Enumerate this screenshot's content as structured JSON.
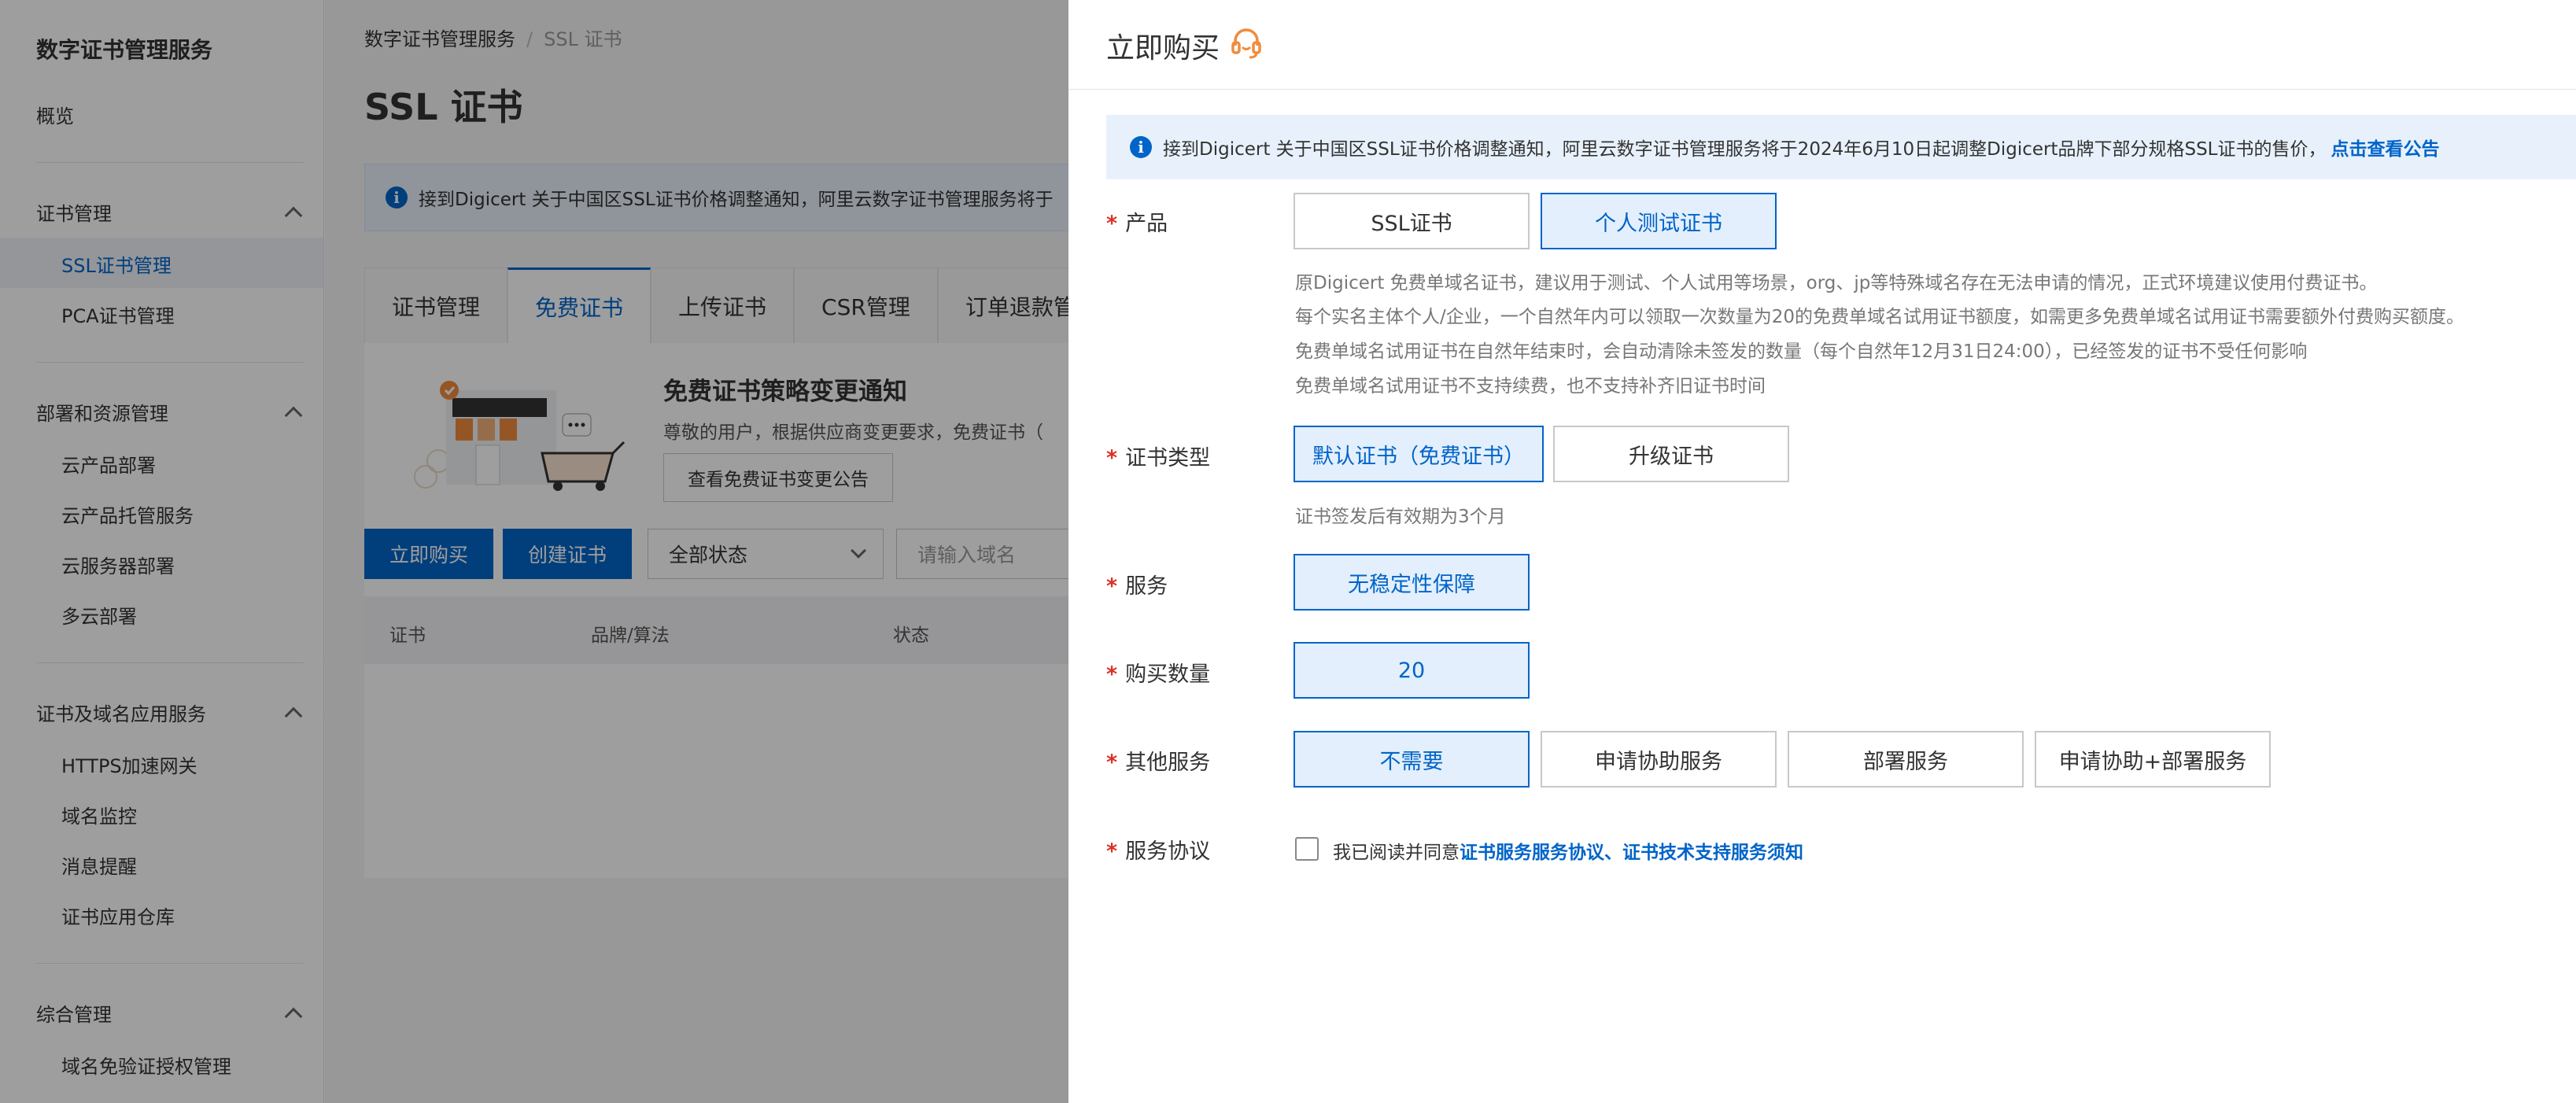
{
  "sidebar": {
    "title": "数字证书管理服务",
    "overview": "概览",
    "groups": [
      {
        "label": "证书管理",
        "items": [
          "SSL证书管理",
          "PCA证书管理"
        ]
      },
      {
        "label": "部署和资源管理",
        "items": [
          "云产品部署",
          "云产品托管服务",
          "云服务器部署",
          "多云部署"
        ]
      },
      {
        "label": "证书及域名应用服务",
        "items": [
          "HTTPS加速网关",
          "域名监控",
          "消息提醒",
          "证书应用仓库"
        ]
      },
      {
        "label": "综合管理",
        "items": [
          "域名免验证授权管理"
        ]
      }
    ],
    "active_item": "SSL证书管理"
  },
  "main": {
    "breadcrumb": {
      "root": "数字证书管理服务",
      "separator": "/",
      "current": "SSL 证书"
    },
    "title": "SSL 证书",
    "notice": "接到Digicert 关于中国区SSL证书价格调整通知，阿里云数字证书管理服务将于",
    "tabs": [
      "证书管理",
      "免费证书",
      "上传证书",
      "CSR管理",
      "订单退款管理"
    ],
    "active_tab": "免费证书",
    "promo": {
      "title": "免费证书策略变更通知",
      "desc": "尊敬的用户，根据供应商变更要求，免费证书（",
      "button": "查看免费证书变更公告"
    },
    "toolbar": {
      "buy_button": "立即购买",
      "create_button": "创建证书",
      "status_select": "全部状态",
      "search_placeholder": "请输入域名"
    },
    "table_headers": [
      "证书",
      "品牌/算法",
      "状态"
    ]
  },
  "drawer": {
    "title": "立即购买",
    "notice": "接到Digicert 关于中国区SSL证书价格调整通知，阿里云数字证书管理服务将于2024年6月10日起调整Digicert品牌下部分规格SSL证书的售价，",
    "notice_link": "点击查看公告",
    "product": {
      "label": "产品",
      "options": [
        "SSL证书",
        "个人测试证书"
      ],
      "selected": "个人测试证书",
      "help": [
        "原Digicert 免费单域名证书，建议用于测试、个人试用等场景，org、jp等特殊域名存在无法申请的情况，正式环境建议使用付费证书。",
        "每个实名主体个人/企业，一个自然年内可以领取一次数量为20的免费单域名试用证书额度，如需更多免费单域名试用证书需要额外付费购买额度。",
        "免费单域名试用证书在自然年结束时，会自动清除未签发的数量（每个自然年12月31日24:00），已经签发的证书不受任何影响",
        "免费单域名试用证书不支持续费，也不支持补齐旧证书时间"
      ]
    },
    "cert_type": {
      "label": "证书类型",
      "options": [
        "默认证书（免费证书）",
        "升级证书"
      ],
      "selected": "默认证书（免费证书）",
      "help": "证书签发后有效期为3个月"
    },
    "service": {
      "label": "服务",
      "options": [
        "无稳定性保障"
      ],
      "selected": "无稳定性保障"
    },
    "quantity": {
      "label": "购买数量",
      "value": "20"
    },
    "other_service": {
      "label": "其他服务",
      "options": [
        "不需要",
        "申请协助服务",
        "部署服务",
        "申请协助+部署服务"
      ],
      "selected": "不需要"
    },
    "agreement": {
      "label": "服务协议",
      "prefix": "我已阅读并同意",
      "link": "证书服务服务协议、证书技术支持服务须知",
      "checked": false
    }
  },
  "colors": {
    "primary": "#0064c8",
    "required": "#d93026",
    "overlay": "rgba(0,0,0,0.38)"
  }
}
